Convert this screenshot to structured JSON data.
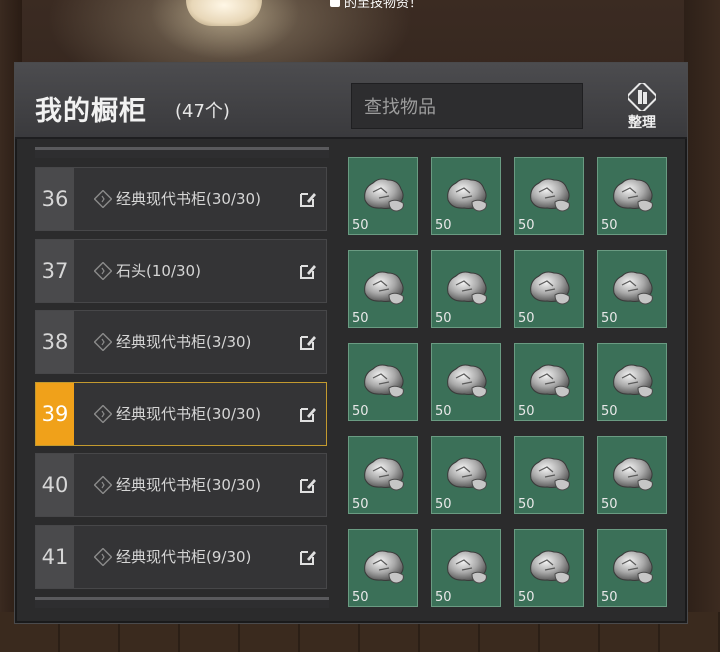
{
  "notice": {
    "text": "的至技物资！"
  },
  "header": {
    "title": "我的橱柜",
    "count": "(47个)",
    "sort_label": "整理"
  },
  "search": {
    "placeholder": "查找物品"
  },
  "cabinet_rows": [
    {
      "number": "36",
      "name": "经典现代书柜(30/30)",
      "active": false
    },
    {
      "number": "37",
      "name": "石头(10/30)",
      "active": false
    },
    {
      "number": "38",
      "name": "经典现代书柜(3/30)",
      "active": false
    },
    {
      "number": "39",
      "name": "经典现代书柜(30/30)",
      "active": true
    },
    {
      "number": "40",
      "name": "经典现代书柜(30/30)",
      "active": false
    },
    {
      "number": "41",
      "name": "经典现代书柜(9/30)",
      "active": false
    }
  ],
  "items": [
    {
      "icon": "rock-icon",
      "qty": "50"
    },
    {
      "icon": "rock-icon",
      "qty": "50"
    },
    {
      "icon": "rock-icon",
      "qty": "50"
    },
    {
      "icon": "rock-icon",
      "qty": "50"
    },
    {
      "icon": "rock-icon",
      "qty": "50"
    },
    {
      "icon": "rock-icon",
      "qty": "50"
    },
    {
      "icon": "rock-icon",
      "qty": "50"
    },
    {
      "icon": "rock-icon",
      "qty": "50"
    },
    {
      "icon": "rock-icon",
      "qty": "50"
    },
    {
      "icon": "rock-icon",
      "qty": "50"
    },
    {
      "icon": "rock-icon",
      "qty": "50"
    },
    {
      "icon": "rock-icon",
      "qty": "50"
    },
    {
      "icon": "rock-icon",
      "qty": "50"
    },
    {
      "icon": "rock-icon",
      "qty": "50"
    },
    {
      "icon": "rock-icon",
      "qty": "50"
    },
    {
      "icon": "rock-icon",
      "qty": "50"
    },
    {
      "icon": "rock-icon",
      "qty": "50"
    },
    {
      "icon": "rock-icon",
      "qty": "50"
    },
    {
      "icon": "rock-icon",
      "qty": "50"
    },
    {
      "icon": "rock-icon",
      "qty": "50"
    }
  ],
  "colors": {
    "active_accent": "#f0a11a",
    "item_bg": "#3b7058"
  }
}
